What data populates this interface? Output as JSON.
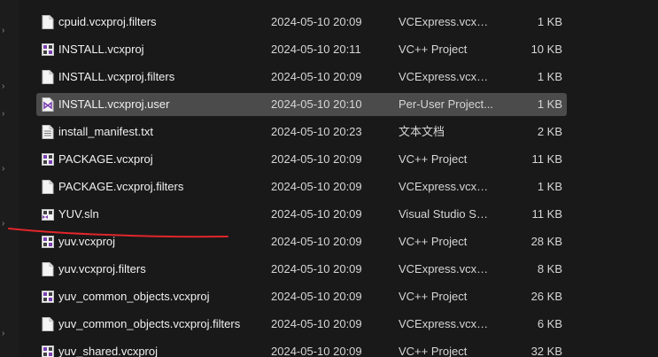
{
  "files": [
    {
      "name": "cpuid.vcxproj.filters",
      "date": "2024-05-10 20:09",
      "type": "VCExpress.vcxpr...",
      "size": "1 KB",
      "icon": "document-icon",
      "selected": false
    },
    {
      "name": "INSTALL.vcxproj",
      "date": "2024-05-10 20:11",
      "type": "VC++ Project",
      "size": "10 KB",
      "icon": "vcxproj-icon",
      "selected": false
    },
    {
      "name": "INSTALL.vcxproj.filters",
      "date": "2024-05-10 20:09",
      "type": "VCExpress.vcxpr...",
      "size": "1 KB",
      "icon": "document-icon",
      "selected": false
    },
    {
      "name": "INSTALL.vcxproj.user",
      "date": "2024-05-10 20:10",
      "type": "Per-User Project...",
      "size": "1 KB",
      "icon": "vs-user-icon",
      "selected": true
    },
    {
      "name": "install_manifest.txt",
      "date": "2024-05-10 20:23",
      "type": "文本文档",
      "size": "2 KB",
      "icon": "text-file-icon",
      "selected": false
    },
    {
      "name": "PACKAGE.vcxproj",
      "date": "2024-05-10 20:09",
      "type": "VC++ Project",
      "size": "11 KB",
      "icon": "vcxproj-icon",
      "selected": false
    },
    {
      "name": "PACKAGE.vcxproj.filters",
      "date": "2024-05-10 20:09",
      "type": "VCExpress.vcxpr...",
      "size": "1 KB",
      "icon": "document-icon",
      "selected": false
    },
    {
      "name": "YUV.sln",
      "date": "2024-05-10 20:09",
      "type": "Visual Studio Sol...",
      "size": "11 KB",
      "icon": "solution-icon",
      "selected": false
    },
    {
      "name": "yuv.vcxproj",
      "date": "2024-05-10 20:09",
      "type": "VC++ Project",
      "size": "28 KB",
      "icon": "vcxproj-icon",
      "selected": false
    },
    {
      "name": "yuv.vcxproj.filters",
      "date": "2024-05-10 20:09",
      "type": "VCExpress.vcxpr...",
      "size": "8 KB",
      "icon": "document-icon",
      "selected": false
    },
    {
      "name": "yuv_common_objects.vcxproj",
      "date": "2024-05-10 20:09",
      "type": "VC++ Project",
      "size": "26 KB",
      "icon": "vcxproj-icon",
      "selected": false
    },
    {
      "name": "yuv_common_objects.vcxproj.filters",
      "date": "2024-05-10 20:09",
      "type": "VCExpress.vcxpr...",
      "size": "6 KB",
      "icon": "document-icon",
      "selected": false
    },
    {
      "name": "yuv_shared.vcxproj",
      "date": "2024-05-10 20:09",
      "type": "VC++ Project",
      "size": "32 KB",
      "icon": "vcxproj-icon",
      "selected": false
    }
  ],
  "colors": {
    "background": "#191919",
    "selection": "#4b4b4b",
    "annotation_stroke": "#e0262b"
  }
}
